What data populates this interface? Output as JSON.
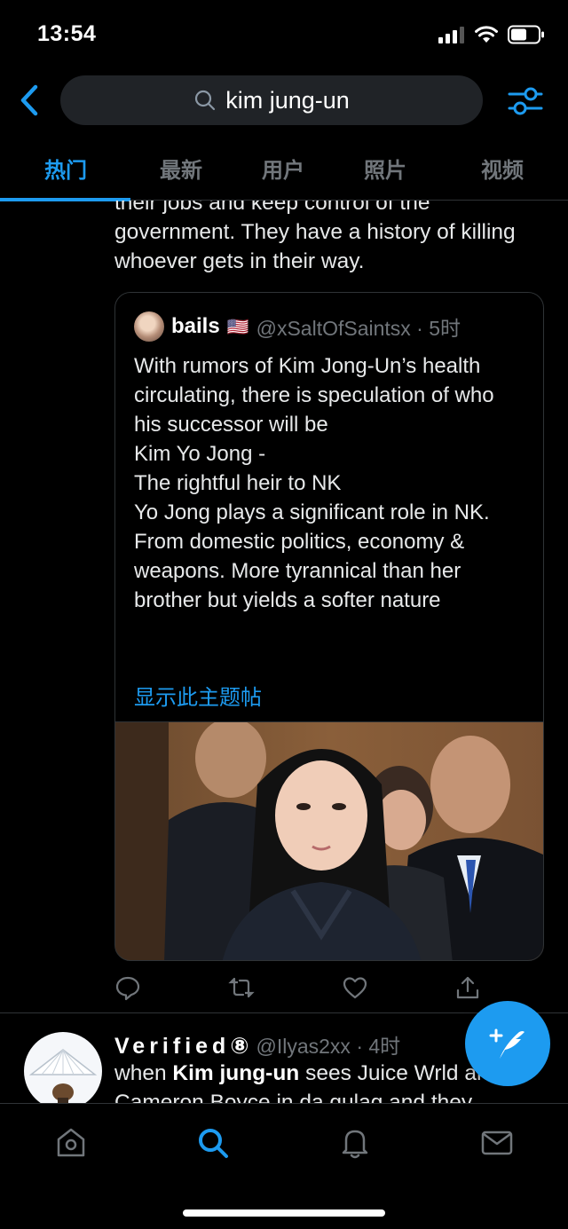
{
  "status_bar": {
    "time": "13:54"
  },
  "search": {
    "query": "kim jung-un"
  },
  "tabs": [
    {
      "label": "热门",
      "active": true
    },
    {
      "label": "最新",
      "active": false
    },
    {
      "label": "用户",
      "active": false
    },
    {
      "label": "照片",
      "active": false
    },
    {
      "label": "视频",
      "active": false
    }
  ],
  "tweet1": {
    "text_continued": "their jobs and keep control of the government. They have a history of killing whoever gets in their way.",
    "quote": {
      "name": "bails",
      "flag": "🇺🇸",
      "handle_time": "@xSaltOfSaintsx · 5时",
      "text": "With rumors of Kim Jong-Un’s health circulating, there is speculation of who his successor will be\nKim Yo Jong -\nThe rightful heir to NK\nYo Jong plays a significant role in NK. From domestic politics, economy & weapons. More tyrannical than her brother but yields a softer nature",
      "show_thread": "显示此主题帖"
    }
  },
  "tweet2": {
    "name": "Verified",
    "name_badge": "⑧",
    "handle_time": "@Ilyas2xx · 4时",
    "text_pre": "when ",
    "text_bold": "Kim jung-un",
    "text_post": " sees Juice Wrld and Cameron Boyce in da gulag and they"
  },
  "colors": {
    "accent": "#1d9bf0",
    "background": "#000000",
    "secondary_text": "#71767b",
    "divider": "#2f3336"
  },
  "icons": [
    "back-arrow-icon",
    "search-icon",
    "filter-sliders-icon",
    "reply-icon",
    "retweet-icon",
    "like-icon",
    "share-icon",
    "compose-icon",
    "home-icon",
    "search-icon",
    "notifications-icon",
    "messages-icon"
  ]
}
